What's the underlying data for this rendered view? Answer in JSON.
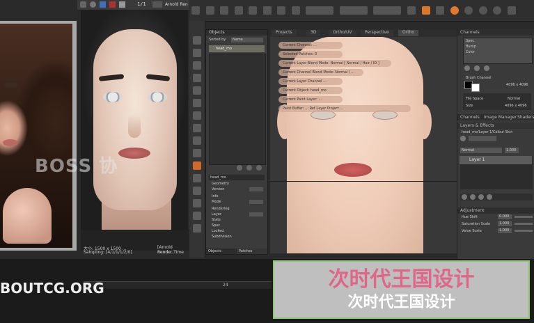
{
  "render_window": {
    "toolbar_counter": "1/1",
    "toolbar_renderer": "Arnold Ren",
    "status_size": "大小: 1500 x 1500 ...",
    "status_sampling": "Sampling: [4/1/1/1/2/0]",
    "status_time": "渲染时间: 0:017",
    "status_renderer": "[Arnold Rende...",
    "status_render_time": "Render Time"
  },
  "objects_panel": {
    "title": "Objects",
    "sort_label": "Sorted by",
    "sort_value": "Name",
    "item": "head_mo",
    "attr_header": "head_mo",
    "attr_sections": [
      "Geometry",
      "Info",
      "Rendering",
      "Stats",
      "Subdivision"
    ],
    "attr_rows": [
      "Version",
      "Mode",
      "Layer",
      "Spec",
      "Locked"
    ],
    "bottom_tabs": [
      "Objects",
      "Patches"
    ]
  },
  "viewport": {
    "tabs": [
      "Projects",
      "3D",
      "Ortho/UV",
      "Perspective",
      "Ortho"
    ],
    "tooltips": [
      "Current Channel: ...",
      "Selected Patches: 0",
      "Current Layer Blend Mode: Normal [ Normal / Hair / ID ]",
      "Current Channel Blend Mode: Normal / ...",
      "Current Layer Channel ...",
      "Current Object: head_mo",
      "Current Paint Layer: ...",
      "Paint Buffer: ... Ref Layer Project ..."
    ]
  },
  "right_panel": {
    "channels_title": "Channels",
    "channels": [
      "Spec",
      "Bump",
      "Color"
    ],
    "brush_title": "Brush Channel",
    "brush_value": "4096 x 4096",
    "file_space_label": "File Space",
    "file_space_value": "Normal",
    "size_label": "Size",
    "size_value": "4096 x 4096",
    "tabs": [
      "Channels",
      "Image Manager",
      "Shaders"
    ],
    "layers_header": "Layers & Effects",
    "layers_sub": "head_mo/Layer 1/Colour Skin",
    "blend_value": "Normal",
    "opacity_value": "1.000",
    "layer_name": "Layer 1",
    "adjustment_title": "Adjustment",
    "adj_rows": [
      "Hue Shift",
      "Saturation Scale",
      "Value Scale"
    ],
    "adj_values": [
      "0.000",
      "1.000",
      "1.000"
    ]
  },
  "timeline": {
    "frame_label": "24"
  },
  "watermarks": {
    "boss": "BOSS 协",
    "site": "BOUTCG.ORG"
  },
  "banner": {
    "line1": "次时代王国设计",
    "line2": "次时代王国设计",
    "line1_color": "#e06688",
    "line2_color": "#ffffff",
    "border_color": "#8ec86a"
  }
}
